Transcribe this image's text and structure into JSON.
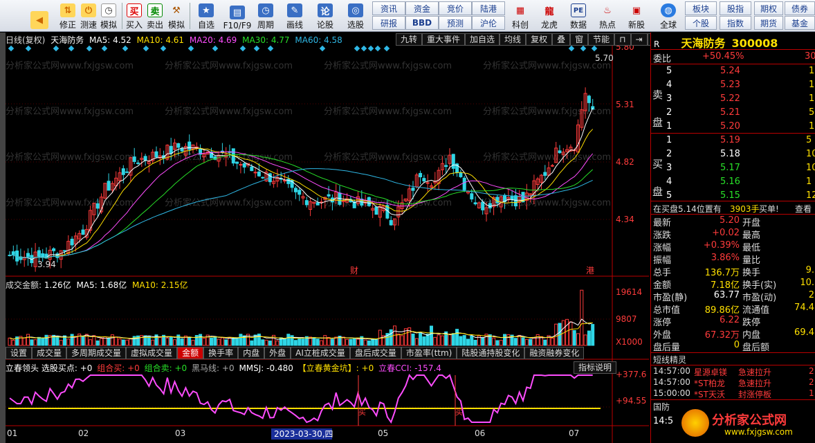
{
  "toolbar": {
    "big_buttons": [
      {
        "label": "",
        "icon": "back-arrow-icon"
      },
      {
        "label": "修正",
        "icon": "up-down-arrows-icon"
      },
      {
        "label": "测速",
        "icon": "power-icon"
      },
      {
        "label": "模拟",
        "icon": "clock-icon"
      },
      {
        "label": "买入",
        "icon": "buy-icon",
        "glyph": "买"
      },
      {
        "label": "卖出",
        "icon": "sell-icon",
        "glyph": "卖"
      },
      {
        "label": "模拟",
        "icon": "hammer-icon"
      },
      {
        "label": "自选",
        "icon": "star-icon"
      },
      {
        "label": "F10/F9",
        "icon": "f10-icon"
      },
      {
        "label": "周期",
        "icon": "period-icon"
      },
      {
        "label": "画线",
        "icon": "pen-icon"
      },
      {
        "label": "论股",
        "icon": "forum-icon"
      },
      {
        "label": "选股",
        "icon": "select-icon"
      }
    ],
    "grid_buttons_row1": [
      "资讯",
      "资金",
      "竞价",
      "陆港"
    ],
    "grid_buttons_row2": [
      "研报",
      "BBD",
      "预测",
      "沪伦"
    ],
    "right_buttons": [
      {
        "label": "科创",
        "icon": "kechuang-icon"
      },
      {
        "label": "龙虎",
        "icon": "dragon-icon"
      },
      {
        "label": "数据",
        "icon": "pe-icon",
        "glyph": "PE"
      },
      {
        "label": "热点",
        "icon": "hot-icon"
      },
      {
        "label": "新股",
        "icon": "new-stock-icon"
      },
      {
        "label": "全球",
        "icon": "globe-icon"
      }
    ],
    "right_grid_row1": [
      "板块",
      "股指",
      "期权",
      "债券"
    ],
    "right_grid_row2": [
      "个股",
      "指数",
      "期货",
      "基金"
    ]
  },
  "kline": {
    "header_prefix": "日线(复权)",
    "stock_name": "天海防务",
    "ma5": "MA5: 4.52",
    "ma10": "MA10: 4.61",
    "ma20": "MA20: 4.69",
    "ma30": "MA30: 4.77",
    "ma60": "MA60: 4.58",
    "right_tools": [
      "九转",
      "重大事件",
      "加自选",
      "均线",
      "复权",
      "叠",
      "窗",
      "节能"
    ],
    "price_axis": [
      "5.80",
      "5.31",
      "4.82",
      "4.34"
    ],
    "high_label": "5.70",
    "low_label": "3.94",
    "marker_cai": "财",
    "marker_gang": "港",
    "watermark": "分析家公式网www.fxjgsw.com"
  },
  "volume": {
    "header_prefix": "成交金额:",
    "amount": "1.26亿",
    "ma5": "MA5: 1.68亿",
    "ma10": "MA10: 2.15亿",
    "axis": [
      "19614",
      "9807",
      "X1000"
    ]
  },
  "tabs": [
    "设置",
    "成交量",
    "多周期成交量",
    "虚拟成交量",
    "金额",
    "换手率",
    "内盘",
    "外盘",
    "AI立桩成交量",
    "盘后成交量",
    "市盈率(ttm)",
    "陆股通持股变化",
    "融资融券变化"
  ],
  "active_tab": "金额",
  "indicator": {
    "name": "立春领头 选股买点:",
    "buy_val": "+0",
    "zhbuy": "组合买:",
    "zhbuy_val": "+0",
    "zhsell": "组合卖:",
    "zhsell_val": "+0",
    "hml": "黑马线:",
    "hml_val": "+0",
    "mmsj": "MMSJ: -0.480",
    "hjk": "【立春黄金坑】: +0",
    "cci": "立春CCI: -157.4",
    "explain_button": "指标说明",
    "axis": [
      "+377.6",
      "+94.55"
    ],
    "mark_buy": "买"
  },
  "date_axis": [
    "01",
    "02",
    "03",
    "2023-03-30,四",
    "05",
    "06",
    "07"
  ],
  "quote": {
    "r_label": "R",
    "title": "天海防务",
    "code": "300008",
    "weibi_label": "委比",
    "weibi_value": "+50.45%",
    "weibi_extra": "30",
    "sell_side": "卖盘",
    "buy_side": "买盘",
    "sell": [
      {
        "level": "5",
        "price": "5.24",
        "vol": "1"
      },
      {
        "level": "4",
        "price": "5.23",
        "vol": "1"
      },
      {
        "level": "3",
        "price": "5.22",
        "vol": "1"
      },
      {
        "level": "2",
        "price": "5.21",
        "vol": "5"
      },
      {
        "level": "1",
        "price": "5.20",
        "vol": "1"
      }
    ],
    "buy": [
      {
        "level": "1",
        "price": "5.19",
        "vol": "5"
      },
      {
        "level": "2",
        "price": "5.18",
        "vol": "10"
      },
      {
        "level": "3",
        "price": "5.17",
        "vol": "10"
      },
      {
        "level": "4",
        "price": "5.16",
        "vol": "1"
      },
      {
        "level": "5",
        "price": "5.15",
        "vol": "12"
      }
    ],
    "inbuy_text": "在买盘5.14位置有",
    "inbuy_amount": "3903手",
    "inbuy_suffix": "买单!",
    "inbuy_more": "查看",
    "stats": [
      {
        "l": "最新",
        "v": "5.20",
        "c": "red",
        "l2": "开盘",
        "v2": ""
      },
      {
        "l": "涨跌",
        "v": "+0.02",
        "c": "red",
        "l2": "最高",
        "v2": ""
      },
      {
        "l": "涨幅",
        "v": "+0.39%",
        "c": "red",
        "l2": "最低",
        "v2": ""
      },
      {
        "l": "振幅",
        "v": "3.86%",
        "c": "red",
        "l2": "量比",
        "v2": ""
      },
      {
        "l": "总手",
        "v": "136.7万",
        "c": "yellow",
        "l2": "换手",
        "v2": "9."
      },
      {
        "l": "金额",
        "v": "7.18亿",
        "c": "yellow",
        "l2": "换手(实)",
        "v2": "10."
      },
      {
        "l": "市盈(静)",
        "v": "63.77",
        "c": "white",
        "l2": "市盈(动)",
        "v2": "2"
      },
      {
        "l": "总市值",
        "v": "89.86亿",
        "c": "yellow",
        "l2": "流通值",
        "v2": "74.4"
      },
      {
        "l": "涨停",
        "v": "6.22",
        "c": "red",
        "l2": "跌停",
        "v2": ""
      },
      {
        "l": "外盘",
        "v": "67.32万",
        "c": "red",
        "l2": "内盘",
        "v2": "69.4"
      },
      {
        "l": "盘后量",
        "v": "0",
        "c": "yellow",
        "l2": "盘后额",
        "v2": ""
      }
    ],
    "short_title": "短线精灵",
    "short_items": [
      {
        "time": "14:57:00",
        "name": "星源卓镁",
        "event": "急速拉升",
        "n": "2"
      },
      {
        "time": "14:57:00",
        "name": "*ST柏龙",
        "event": "急速拉升",
        "n": "2"
      },
      {
        "time": "15:00:00",
        "name": "*ST天沃",
        "event": "封涨停板",
        "n": "1"
      }
    ],
    "bottom_label": "国防",
    "bottom_time": "14:5",
    "logo_text": "分析家公式网",
    "logo_url": "www.fxjgsw.com"
  },
  "colors": {
    "up": "#ff3b3b",
    "down": "#2fd6e6",
    "ma5": "#ffffff",
    "ma10": "#ffe000",
    "ma20": "#ff4dff",
    "ma30": "#28e028",
    "ma60": "#2fb8e6"
  }
}
